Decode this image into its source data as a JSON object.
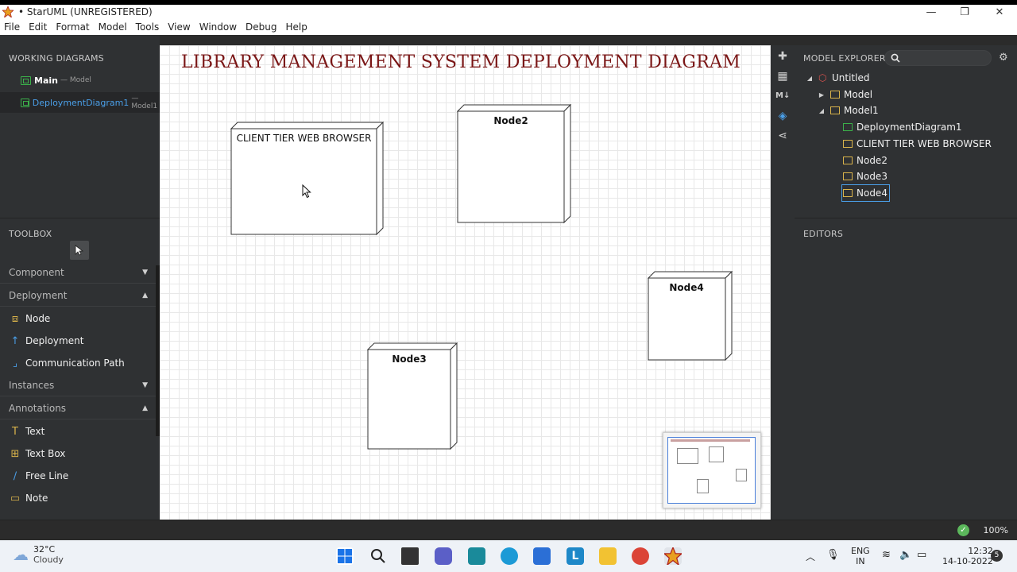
{
  "window": {
    "title": "• StarUML (UNREGISTERED)"
  },
  "window_controls": {
    "minimize": "—",
    "restore": "❐",
    "close": "✕"
  },
  "menu": [
    "File",
    "Edit",
    "Format",
    "Model",
    "Tools",
    "View",
    "Window",
    "Debug",
    "Help"
  ],
  "working_diagrams": {
    "header": "WORKING DIAGRAMS",
    "items": [
      {
        "name": "Main",
        "sub": "— Model"
      },
      {
        "name": "DeploymentDiagram1",
        "sub": "— Model1"
      }
    ]
  },
  "toolbox": {
    "header": "TOOLBOX",
    "categories": {
      "component": "Component",
      "deployment": "Deployment",
      "instances": "Instances",
      "annotations": "Annotations"
    },
    "deployment_items": [
      "Node",
      "Deployment",
      "Communication Path"
    ],
    "annotation_items": [
      "Text",
      "Text Box",
      "Free Line",
      "Note"
    ]
  },
  "diagram": {
    "title": "LIBRARY MANAGEMENT SYSTEM DEPLOYMENT DIAGRAM",
    "nodes": [
      "CLIENT TIER WEB BROWSER",
      "Node2",
      "Node3",
      "Node4"
    ]
  },
  "model_explorer": {
    "header": "MODEL EXPLORER",
    "tree": {
      "root": "Untitled",
      "model": "Model",
      "model1": "Model1",
      "children": [
        "DeploymentDiagram1",
        "CLIENT TIER WEB BROWSER",
        "Node2",
        "Node3",
        "Node4"
      ]
    }
  },
  "editors": {
    "header": "EDITORS"
  },
  "status": {
    "zoom": "100%"
  },
  "taskbar": {
    "temp": "32°C",
    "condition": "Cloudy",
    "lang_top": "ENG",
    "lang_bottom": "IN",
    "time": "12:32",
    "date": "14-10-2022",
    "notif": "5"
  },
  "colors": {
    "title_red": "#7a1616",
    "accent_blue": "#4a9fe8",
    "icon_green": "#3bb04a",
    "icon_gold": "#d9b34b"
  }
}
